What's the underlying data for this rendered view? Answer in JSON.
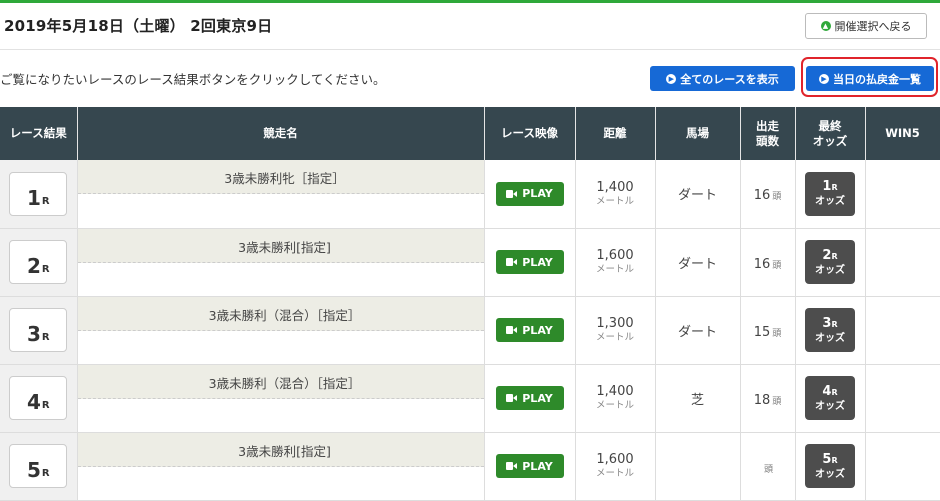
{
  "header": {
    "title": "2019年5月18日（土曜） 2回東京9日",
    "back_label": "開催選択へ戻る"
  },
  "instruction": "ご覧になりたいレースのレース結果ボタンをクリックしてください。",
  "buttons": {
    "all_races": "全てのレースを表示",
    "payout_list": "当日の払戻金一覧"
  },
  "table": {
    "headers": {
      "result": "レース結果",
      "name": "競走名",
      "video": "レース映像",
      "distance": "距離",
      "track": "馬場",
      "runners_l1": "出走",
      "runners_l2": "頭数",
      "odds_l1": "最終",
      "odds_l2": "オッズ",
      "win5": "WIN5"
    },
    "race_suffix": "R",
    "play_label": "PLAY",
    "distance_unit": "メートル",
    "runners_unit": "頭",
    "odds_label": "オッズ",
    "rows": [
      {
        "num": "1",
        "name": "3歳未勝利牝［指定］",
        "distance": "1,400",
        "track": "ダート",
        "runners": "16"
      },
      {
        "num": "2",
        "name": "3歳未勝利[指定]",
        "distance": "1,600",
        "track": "ダート",
        "runners": "16"
      },
      {
        "num": "3",
        "name": "3歳未勝利（混合）［指定］",
        "distance": "1,300",
        "track": "ダート",
        "runners": "15"
      },
      {
        "num": "4",
        "name": "3歳未勝利（混合）［指定］",
        "distance": "1,400",
        "track": "芝",
        "runners": "18"
      },
      {
        "num": "5",
        "name": "3歳未勝利[指定]",
        "distance": "1,600",
        "track": "",
        "runners": ""
      }
    ]
  },
  "colors": {
    "header_bg": "#36474f",
    "primary_blue": "#1669d6",
    "play_green": "#2e8a2a",
    "highlight_red": "#e0242b"
  }
}
